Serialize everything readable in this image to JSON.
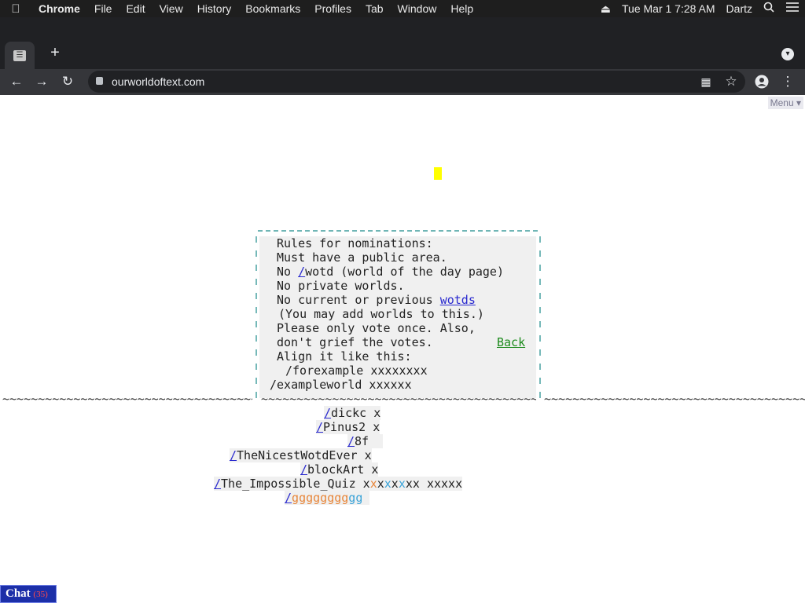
{
  "menubar": {
    "items": [
      "Chrome",
      "File",
      "Edit",
      "View",
      "History",
      "Bookmarks",
      "Profiles",
      "Tab",
      "Window",
      "Help"
    ],
    "clock": "Tue Mar 1  7:28 AM",
    "user": "Dartz"
  },
  "tab": {
    "new_tab_label": "+"
  },
  "toolbar": {
    "url": "ourworldoftext.com"
  },
  "page": {
    "menu_label": "Menu ▾",
    "rules": {
      "line1": "Rules for nominations:",
      "line2": "Must have a public area.",
      "line3_pre": "No ",
      "line3_link": "/",
      "line3_post": "wotd (world of the day page)",
      "line4": "No private worlds.",
      "line5_pre": "No current or previous ",
      "line5_link": "wotds",
      "line6": "(You may add worlds to this.)",
      "line7": "Please only vote once. Also,",
      "line8_pre": "don't grief the votes.",
      "line8_link": "Back",
      "line9": "Align it like this:",
      "line10": "/forexample xxxxxxxx",
      "line11": "/exampleworld xxxxxx"
    },
    "entries": [
      {
        "slash": "/",
        "name": "dickc",
        "votes": "x"
      },
      {
        "slash": "/",
        "name": "Pinus2",
        "votes": "x"
      },
      {
        "slash": "/",
        "name": "8f",
        "votes": ""
      },
      {
        "slash": "/",
        "name": "TheNicestWotdEver",
        "votes": "x"
      },
      {
        "slash": "/",
        "name": "blockArt",
        "votes": "x"
      },
      {
        "slash": "/",
        "name": "The_Impossible_Quiz",
        "votes": "xxxxxxxx xxxxx"
      },
      {
        "slash": "/",
        "name": "gggggggggg",
        "votes": ""
      }
    ]
  },
  "chat": {
    "label": "Chat",
    "count": "(35)"
  }
}
